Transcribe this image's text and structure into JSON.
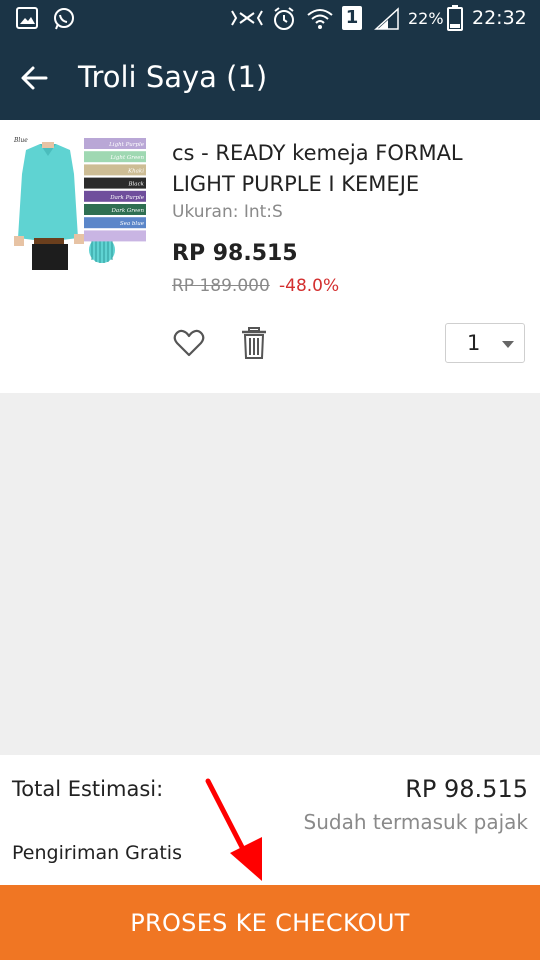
{
  "status_bar": {
    "battery": "22%",
    "time": "22:32",
    "sim_slot": "1",
    "icons": [
      "gallery-icon",
      "whatsapp-icon",
      "mute-icon",
      "alarm-icon",
      "wifi-icon",
      "sim-icon",
      "signal-icon",
      "battery-icon"
    ]
  },
  "header": {
    "title": "Troli Saya (1)",
    "back_icon": "arrow-left-icon"
  },
  "cart": {
    "items": [
      {
        "name": "cs -  READY kemeja FORMAL LIGHT PURPLE I KEMEJE",
        "variant": "Ukuran: Int:S",
        "price": "RP 98.515",
        "original_price": "RP 189.000",
        "discount": "-48.0%",
        "quantity": "1",
        "thumbnail": {
          "shirt_color": "#5fd3d2",
          "labels": [
            "Blue",
            "Light Purple",
            "Light Green",
            "Khaki",
            "Black",
            "Dark Purple",
            "Dark Green",
            "Sea blue"
          ],
          "swatches": [
            "#b9a7d6",
            "#9fd8b2",
            "#cdbd95",
            "#2b2b2b",
            "#6f4e9c",
            "#2f6f52",
            "#5b86c9",
            "#c9b5e3"
          ]
        }
      }
    ]
  },
  "summary": {
    "total_label": "Total Estimasi:",
    "total_value": "RP 98.515",
    "tax_note": "Sudah termasuk pajak",
    "shipping_label": "Pengiriman Gratis"
  },
  "checkout": {
    "label": "PROSES KE CHECKOUT"
  },
  "colors": {
    "header_bg": "#1b3446",
    "accent_orange": "#f07623",
    "discount_red": "#d32f2f",
    "annotation_red": "#ff0000"
  }
}
